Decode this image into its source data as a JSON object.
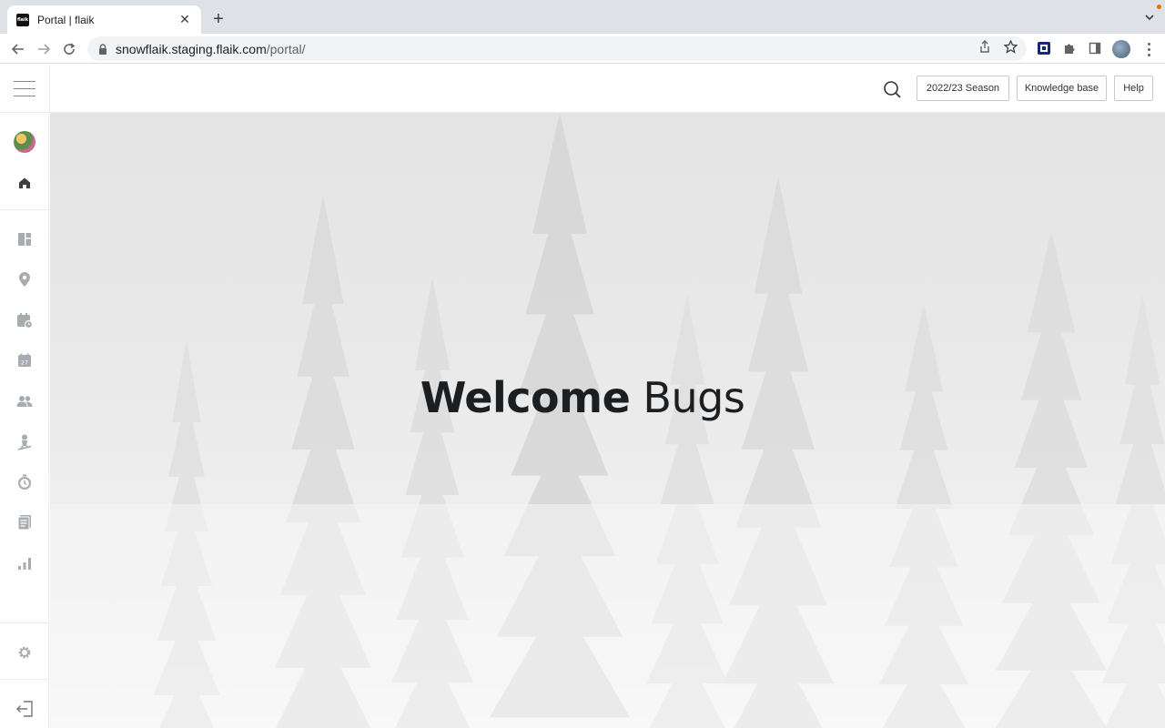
{
  "browser": {
    "tab_title": "Portal | flaik",
    "favicon_text": "flaik",
    "url_host": "snowflaik.staging.flaik.com",
    "url_path": "/portal/"
  },
  "header": {
    "season_label": "2022/23 Season",
    "knowledge_label": "Knowledge base",
    "help_label": "Help"
  },
  "sidebar": {
    "calendar_day": "27",
    "items": [
      "home",
      "dashboard",
      "locations",
      "schedule",
      "calendar",
      "clients",
      "instructors",
      "timesheets",
      "documents",
      "reports",
      "settings",
      "logout"
    ]
  },
  "main": {
    "welcome_word": "Welcome",
    "user_name": "Bugs"
  },
  "colors": {
    "accent": "#1c1f22",
    "icon_gray": "#9aa0a6",
    "home_icon": "#3c4043"
  }
}
